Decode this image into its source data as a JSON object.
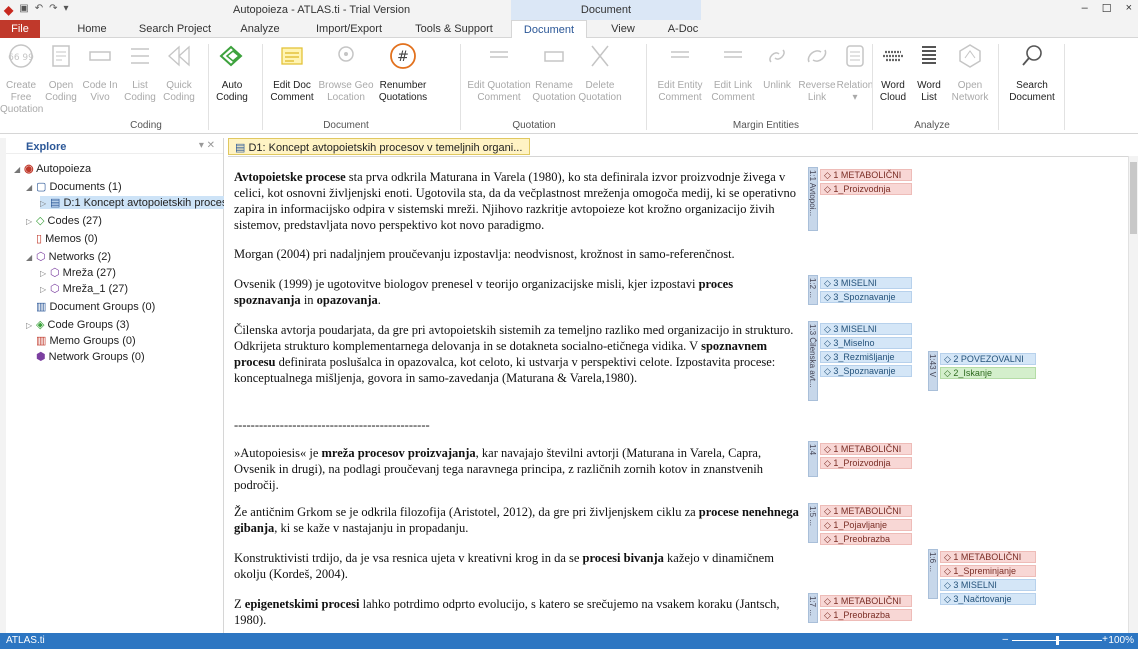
{
  "window": {
    "title": "Autopoieza - ATLAS.ti - Trial Version",
    "context_tab_title": "Document",
    "minimize": "–",
    "maximize": "☐",
    "close": "×"
  },
  "tabs": [
    "File",
    "Home",
    "Search Project",
    "Analyze",
    "Import/Export",
    "Tools & Support",
    "Document",
    "View",
    "A-Doc"
  ],
  "active_tab": "Document",
  "ribbon": {
    "buttons": [
      {
        "l1": "Create Free",
        "l2": "Quotation",
        "enabled": false,
        "icon": "quote-icon"
      },
      {
        "l1": "Open",
        "l2": "Coding",
        "enabled": false,
        "icon": "open-coding-icon"
      },
      {
        "l1": "Code In",
        "l2": "Vivo",
        "enabled": false,
        "icon": "code-in-vivo-icon"
      },
      {
        "l1": "List",
        "l2": "Coding",
        "enabled": false,
        "icon": "list-coding-icon"
      },
      {
        "l1": "Quick",
        "l2": "Coding",
        "enabled": false,
        "icon": "quick-coding-icon"
      },
      {
        "l1": "Auto",
        "l2": "Coding",
        "enabled": true,
        "icon": "auto-coding-icon"
      },
      {
        "l1": "Edit Doc",
        "l2": "Comment",
        "enabled": true,
        "icon": "edit-doc-comment-icon"
      },
      {
        "l1": "Browse Geo",
        "l2": "Location",
        "enabled": false,
        "icon": "geo-location-icon"
      },
      {
        "l1": "Renumber",
        "l2": "Quotations",
        "enabled": true,
        "icon": "renumber-icon"
      },
      {
        "l1": "Edit Quotation",
        "l2": "Comment",
        "enabled": false,
        "icon": "edit-quotation-comment-icon"
      },
      {
        "l1": "Rename",
        "l2": "Quotation",
        "enabled": false,
        "icon": "rename-quotation-icon"
      },
      {
        "l1": "Delete",
        "l2": "Quotation",
        "enabled": false,
        "icon": "delete-quotation-icon"
      },
      {
        "l1": "Edit Entity",
        "l2": "Comment",
        "enabled": false,
        "icon": "edit-entity-comment-icon"
      },
      {
        "l1": "Edit Link",
        "l2": "Comment",
        "enabled": false,
        "icon": "edit-link-comment-icon"
      },
      {
        "l1": "Unlink",
        "l2": "",
        "enabled": false,
        "icon": "unlink-icon"
      },
      {
        "l1": "Reverse",
        "l2": "Link",
        "enabled": false,
        "icon": "reverse-link-icon"
      },
      {
        "l1": "Relation",
        "l2": "▾",
        "enabled": false,
        "icon": "relation-icon"
      },
      {
        "l1": "Word",
        "l2": "Cloud",
        "enabled": true,
        "icon": "word-cloud-icon"
      },
      {
        "l1": "Word",
        "l2": "List",
        "enabled": true,
        "icon": "word-list-icon"
      },
      {
        "l1": "Open",
        "l2": "Network",
        "enabled": false,
        "icon": "open-network-icon"
      },
      {
        "l1": "Search",
        "l2": "Document",
        "enabled": true,
        "icon": "search-icon"
      }
    ],
    "groups": [
      "Coding",
      "Document",
      "Quotation",
      "Margin Entities",
      "Analyze"
    ]
  },
  "explore": {
    "title": "Explore",
    "tree": [
      {
        "label": "Autopoieza",
        "icon": "project-icon"
      },
      {
        "label": "Documents (1)",
        "icon": "folder-icon"
      },
      {
        "label": "D:1 Koncept avtopoietskih procesov v temeljnih organi...",
        "icon": "document-icon"
      },
      {
        "label": "Codes (27)",
        "icon": "code-icon"
      },
      {
        "label": "Memos (0)",
        "icon": "memo-icon"
      },
      {
        "label": "Networks (2)",
        "icon": "network-icon"
      },
      {
        "label": "Mreža (27)",
        "icon": "network-icon"
      },
      {
        "label": "Mreža_1 (27)",
        "icon": "network-icon"
      },
      {
        "label": "Document Groups (0)",
        "icon": "document-group-icon"
      },
      {
        "label": "Code Groups (3)",
        "icon": "code-group-icon"
      },
      {
        "label": "Memo Groups (0)",
        "icon": "memo-group-icon"
      },
      {
        "label": "Network Groups (0)",
        "icon": "network-group-icon"
      }
    ]
  },
  "doc_tab": {
    "label": "D1: Koncept avtopoietskih procesov v temeljnih organi...",
    "close": "×"
  },
  "document": {
    "p1": {
      "bold": "Avtopoietske procese",
      "rest": " sta prva odkrila Maturana in Varela (1980), ko sta definirala izvor proizvodnje živega v celici, kot osnovni življenjski enoti. Ugotovila sta, da da večplastnost mreženja omogoča medij, ki se operativno zapira in informacijsko odpira v sistemski mreži. Njihovo razkritje avtopoieze kot krožno organizacijo živih sistemov, predstavljata novo perspektivo kot novo paradigmo."
    },
    "p2": "Morgan (2004) pri nadaljnjem proučevanju izpostavlja: neodvisnost, krožnost in samo-referenčnost.",
    "p3": {
      "a": "Ovsenik (1999) je ugotovitve biologov prenesel v teorijo organizacijske misli, kjer izpostavi ",
      "b1": "proces spoznavanja",
      "c": " in ",
      "b2": "opazovanja",
      "d": "."
    },
    "p4": {
      "a": "Čilenska avtorja poudarjata, da gre pri avtopoietskih sistemih za temeljno razliko med organizacijo in strukturo. Odkrijeta strukturo komplementarnega delovanja in se dotakneta socialno-etičnega vidika. V ",
      "b": "spoznavnem procesu",
      "c": " definirata poslušalca in opazovalca, kot celoto, ki ustvarja v perspektivi celote. Izpostavita procese: konceptualnega mišljenja, govora in samo-zavedanja (Maturana & Varela,1980)."
    },
    "divider": "-----------------------------------------------",
    "p5": {
      "a": "»Autopoiesis« je ",
      "b": "mreža procesov proizvajanja",
      "c": ", kar navajajo številni avtorji (Maturana in Varela, Capra, Ovsenik in drugi), na podlagi  proučevanj tega naravnega principa, z različnih zornih kotov in znanstvenih področij."
    },
    "p6": {
      "a": "Že antičnim Grkom se je odkrila filozofija (Aristotel, 2012), da gre pri življenjskem ciklu za ",
      "b": "procese nenehnega gibanja",
      "c": ", ki se kaže v nastajanju in propadanju."
    },
    "p7": {
      "a": "Konstruktivisti trdijo, da je vsa resnica ujeta v kreativni krog in da se ",
      "b": "procesi bivanja",
      "c": " kažejo v dinamičnem okolju (Kordeš, 2004)."
    },
    "p8": {
      "a": "Z ",
      "b": "epigenetskimi procesi",
      "c": " lahko potrdimo odprto evolucijo, s katero se srečujemo na vsakem koraku (Jantsch, 1980)."
    }
  },
  "margin": {
    "quotes": [
      "1:1 Avtopoi...",
      "1:2 ...",
      "1:3 Čilenska avt...",
      "1:43 V s...",
      "1:4 »Aut...",
      "1:5 ...",
      "1:6 ...",
      "1:7 ..."
    ],
    "codes": {
      "q1": [
        "◇ 1 METABOLIČNI",
        "◇ 1_Proizvodnja"
      ],
      "q2": [
        "◇ 3 MISELNI",
        "◇ 3_Spoznavanje"
      ],
      "q3": [
        "◇ 3 MISELNI",
        "◇ 3_Miselno",
        "◇ 3_Rezmišljanje",
        "◇ 3_Spoznavanje"
      ],
      "q43": [
        "◇ 2 POVEZOVALNI",
        "◇ 2_Iskanje"
      ],
      "q4": [
        "◇ 1 METABOLIČNI",
        "◇ 1_Proizvodnja"
      ],
      "q5": [
        "◇ 1 METABOLIČNI",
        "◇ 1_Pojavljanje",
        "◇ 1_Preobrazba"
      ],
      "q6": [
        "◇ 1 METABOLIČNI",
        "◇ 1_Spreminjanje",
        "◇ 3 MISELNI",
        "◇ 3_Načrtovanje"
      ],
      "q7": [
        "◇ 1 METABOLIČNI",
        "◇ 1_Preobrazba"
      ]
    }
  },
  "status": {
    "app": "ATLAS.ti",
    "zoom": "100%",
    "zoom_minus": "–",
    "zoom_plus": "+"
  },
  "colors": {
    "file_tab": "#c0392b",
    "status_bar": "#2d76c2",
    "metabolic": "#f8d7d5",
    "mental": "#d4e6f7",
    "connective": "#d4efcc"
  }
}
